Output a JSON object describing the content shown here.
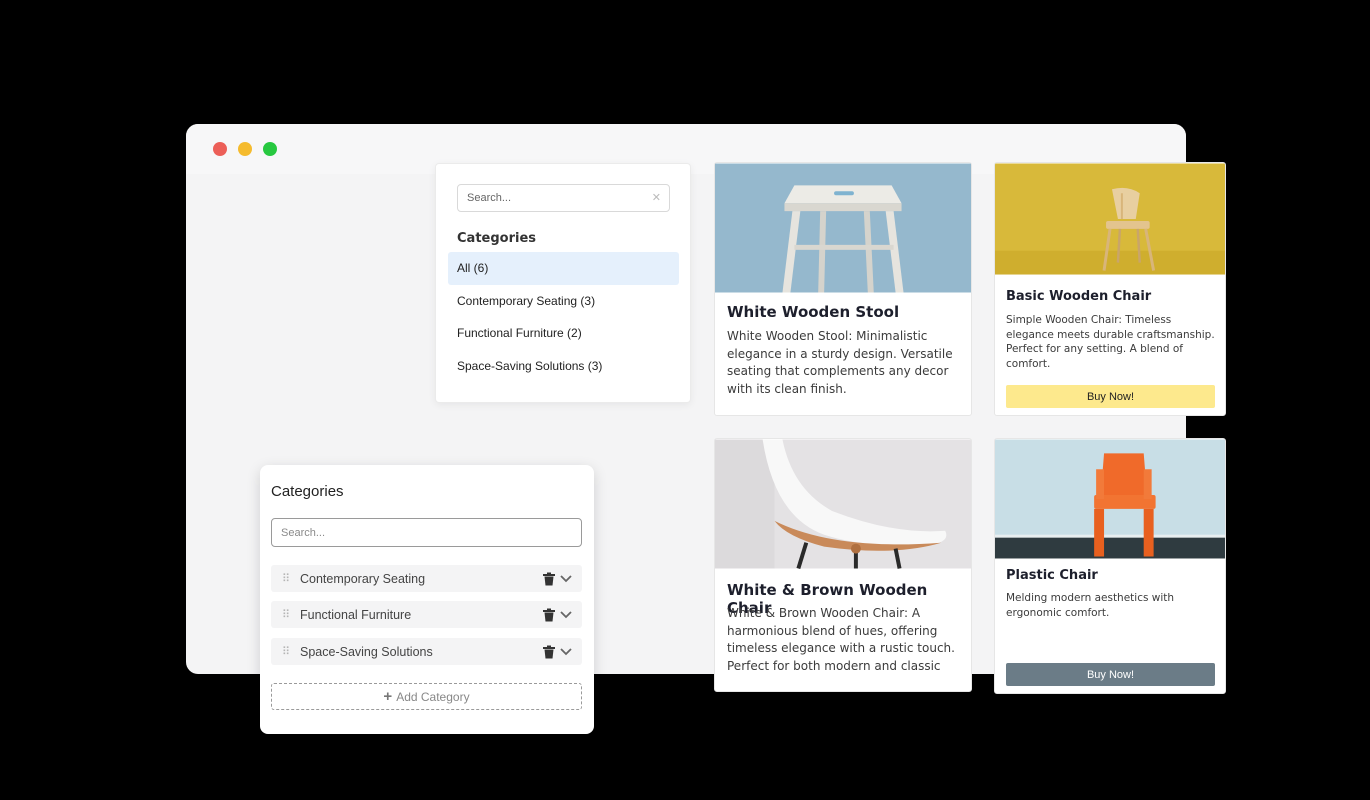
{
  "window": {
    "controls": [
      "close",
      "minimize",
      "maximize"
    ],
    "dot_colors": [
      "#ec5f58",
      "#f5bb2e",
      "#27c840"
    ]
  },
  "filter": {
    "search_placeholder": "Search...",
    "clear_glyph": "✕",
    "categories_title": "Categories",
    "items": [
      {
        "label": "All (6)",
        "active": true
      },
      {
        "label": "Contemporary Seating (3)",
        "active": false
      },
      {
        "label": "Functional Furniture (2)",
        "active": false
      },
      {
        "label": "Space-Saving Solutions (3)",
        "active": false
      }
    ]
  },
  "editor": {
    "title": "Categories",
    "search_placeholder": "Search...",
    "rows": [
      {
        "label": "Contemporary Seating"
      },
      {
        "label": "Functional Furniture"
      },
      {
        "label": "Space-Saving Solutions"
      }
    ],
    "add_label": "Add Category"
  },
  "products": [
    {
      "title": "White Wooden Stool",
      "description": "White Wooden Stool: Minimalistic elegance in a sturdy design. Versatile seating that complements any decor with its clean finish."
    },
    {
      "title": "Basic Wooden Chair",
      "description": "Simple Wooden Chair: Timeless elegance meets durable craftsmanship. Perfect for any setting. A blend of comfort.",
      "button": "Buy Now!"
    },
    {
      "title": "White & Brown Wooden Chair",
      "description": "White & Brown Wooden Chair: A harmonious blend of hues, offering timeless elegance with a rustic touch. Perfect for both modern and classic"
    },
    {
      "title": "Plastic Chair",
      "description": "Melding modern aesthetics with ergonomic comfort.",
      "button": "Buy Now!"
    }
  ],
  "colors": {
    "yellow_button": "#fde98d",
    "gray_button": "#6b7c87",
    "active_category": "#e5f0fc"
  }
}
